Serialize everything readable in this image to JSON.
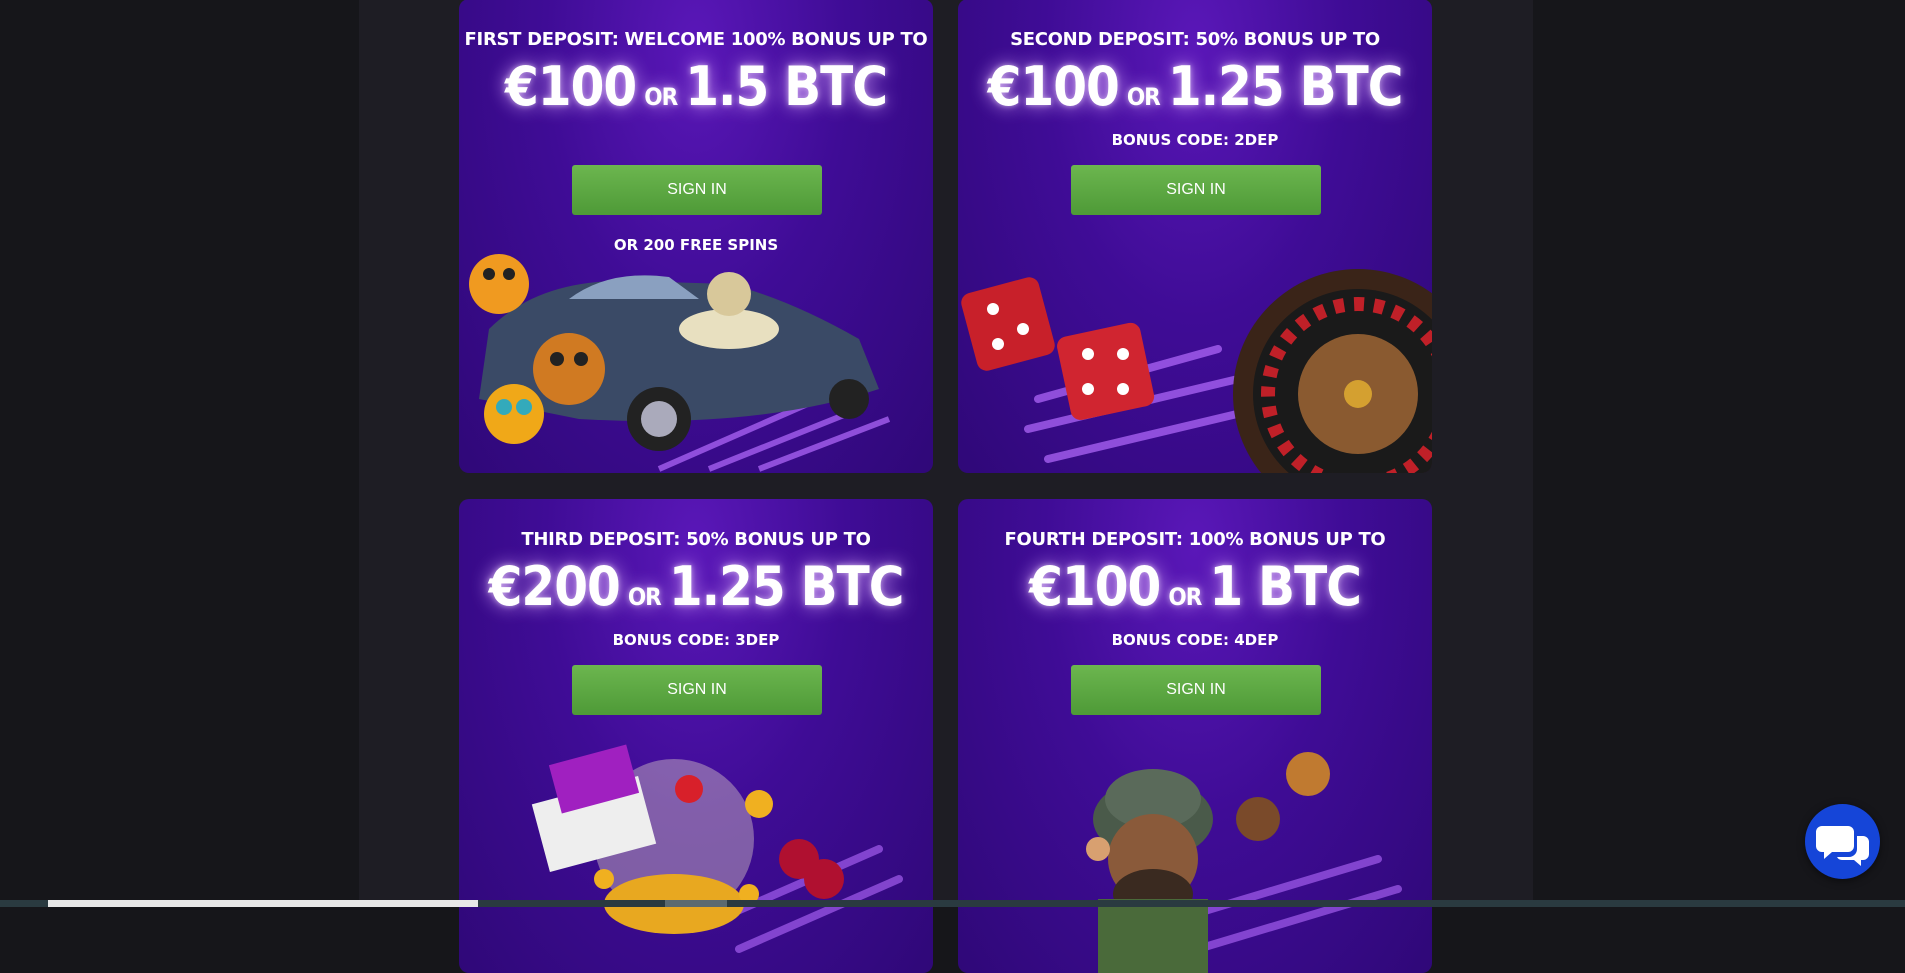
{
  "promotions": [
    {
      "title": "FIRST DEPOSIT: WELCOME 100% BONUS UP TO",
      "amount_fiat": "€100",
      "or_label": "OR",
      "amount_crypto": "1.5 BTC",
      "bonus_code": "",
      "button_label": "SIGN IN",
      "extra_note": "OR 200 FREE SPINS",
      "artwork": "cartoon-animals-car-money-bag"
    },
    {
      "title": "SECOND DEPOSIT: 50% BONUS UP TO",
      "amount_fiat": "€100",
      "or_label": "OR",
      "amount_crypto": "1.25 BTC",
      "bonus_code": "BONUS CODE: 2DEP",
      "button_label": "SIGN IN",
      "artwork": "dice-roulette-wheel"
    },
    {
      "title": "THIRD DEPOSIT: 50% BONUS UP TO",
      "amount_fiat": "€200",
      "or_label": "OR",
      "amount_crypto": "1.25 BTC",
      "bonus_code": "BONUS CODE: 3DEP",
      "button_label": "SIGN IN",
      "artwork": "gift-box-coins-fruits"
    },
    {
      "title": "FOURTH DEPOSIT: 100% BONUS UP TO",
      "amount_fiat": "€100",
      "or_label": "OR",
      "amount_crypto": "1 BTC",
      "bonus_code": "BONUS CODE: 4DEP",
      "button_label": "SIGN IN",
      "artwork": "explorer-character-coins"
    }
  ],
  "chat_widget": {
    "icon": "chat-bubbles-icon"
  },
  "colors": {
    "page_background": "#16161a",
    "card_purple": "#3f0c96",
    "button_green": "#5aa840",
    "chat_blue": "#1545d8"
  }
}
